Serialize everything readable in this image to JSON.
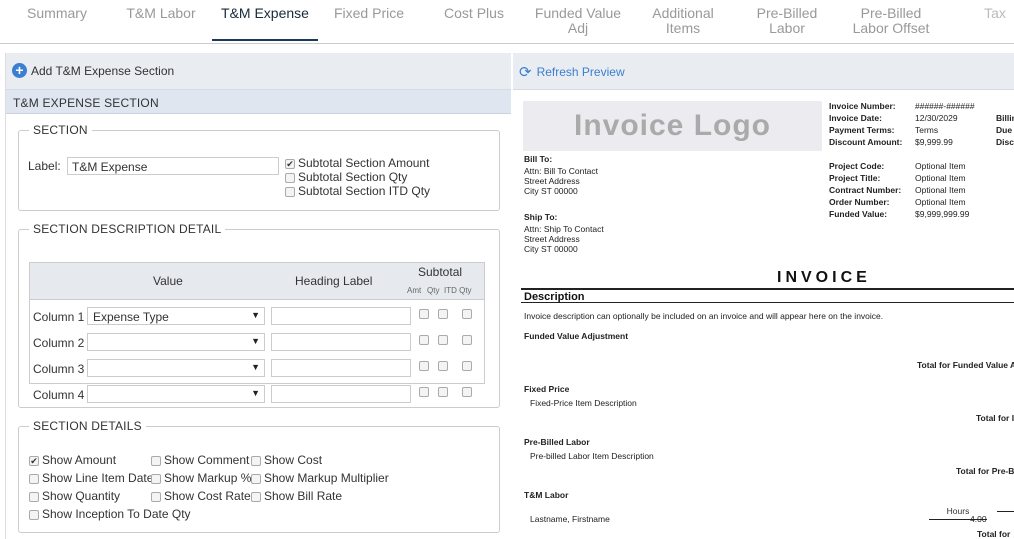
{
  "tabs": [
    {
      "label": "Summary"
    },
    {
      "label": "T&M Labor"
    },
    {
      "label": "T&M Expense"
    },
    {
      "label": "Fixed Price"
    },
    {
      "label": "Cost Plus"
    },
    {
      "label": "Funded Value Adj"
    },
    {
      "label": "Additional Items"
    },
    {
      "label": "Pre-Billed Labor"
    },
    {
      "label": "Pre-Billed Labor Offset"
    },
    {
      "label": "Tax"
    }
  ],
  "left": {
    "add_button": "Add T&M Expense Section",
    "section_bar": "T&M EXPENSE SECTION",
    "section": {
      "legend": "SECTION",
      "label_caption": "Label:",
      "label_value": "T&M Expense",
      "checks": [
        {
          "label": "Subtotal Section Amount",
          "checked": "✔"
        },
        {
          "label": "Subtotal Section Qty",
          "checked": ""
        },
        {
          "label": "Subtotal Section ITD Qty",
          "checked": ""
        }
      ]
    },
    "desc": {
      "legend": "SECTION DESCRIPTION DETAIL",
      "col_value": "Value",
      "col_heading": "Heading Label",
      "col_subtotal": "Subtotal",
      "sub_amt": "Amt",
      "sub_qty": "Qty",
      "sub_itd": "ITD Qty",
      "rows": [
        {
          "label": "Column 1",
          "value": "Expense Type"
        },
        {
          "label": "Column 2",
          "value": ""
        },
        {
          "label": "Column 3",
          "value": ""
        },
        {
          "label": "Column 4",
          "value": ""
        }
      ]
    },
    "details": {
      "legend": "SECTION DETAILS",
      "items": [
        {
          "label": "Show Amount",
          "checked": "✔"
        },
        {
          "label": "Show Comment",
          "checked": ""
        },
        {
          "label": "Show Cost",
          "checked": ""
        },
        {
          "label": "Show Line Item Date",
          "checked": ""
        },
        {
          "label": "Show Markup %",
          "checked": ""
        },
        {
          "label": "Show Markup Multiplier",
          "checked": ""
        },
        {
          "label": "Show Quantity",
          "checked": ""
        },
        {
          "label": "Show Cost Rate",
          "checked": ""
        },
        {
          "label": "Show Bill Rate",
          "checked": ""
        },
        {
          "label": "Show Inception To Date Qty",
          "checked": ""
        }
      ]
    }
  },
  "right": {
    "refresh": "Refresh Preview",
    "invoice": {
      "logo": "Invoice Logo",
      "meta": [
        {
          "k": "Invoice Number:",
          "v": "######-######"
        },
        {
          "k": "Invoice Date:",
          "v": "12/30/2029"
        },
        {
          "k": "Payment Terms:",
          "v": "Terms"
        },
        {
          "k": "Discount Amount:",
          "v": "$9,999.99"
        }
      ],
      "meta_right": [
        "Billin",
        "Due",
        "Disco"
      ],
      "project": [
        {
          "k": "Project Code:",
          "v": "Optional Item"
        },
        {
          "k": "Project Title:",
          "v": "Optional Item"
        },
        {
          "k": "Contract Number:",
          "v": "Optional Item"
        },
        {
          "k": "Order Number:",
          "v": "Optional Item"
        },
        {
          "k": "Funded Value:",
          "v": "$9,999,999.99"
        }
      ],
      "bill_to": {
        "title": "Bill To:",
        "l1": "Attn: Bill To Contact",
        "l2": "Street Address",
        "l3": "City ST 00000"
      },
      "ship_to": {
        "title": "Ship To:",
        "l1": "Attn: Ship To Contact",
        "l2": "Street Address",
        "l3": "City ST 00000"
      },
      "heading": "INVOICE",
      "desc_title": "Description",
      "desc_text": "Invoice description can optionally be included on an invoice and will appear here on the invoice.",
      "fva": "Funded Value Adjustment",
      "fva_total": "Total for Funded Value A",
      "fp": "Fixed Price",
      "fp_item": "Fixed-Price Item Description",
      "fp_total": "Total for I",
      "pbl": "Pre-Billed Labor",
      "pbl_item": "Pre-billed Labor Item Description",
      "pbl_total": "Total for Pre-B",
      "tm": "T&M Labor",
      "hours": "Hours",
      "name": "Lastname, Firstname",
      "hours_val": "4.00",
      "tm_total": "Total for"
    }
  }
}
